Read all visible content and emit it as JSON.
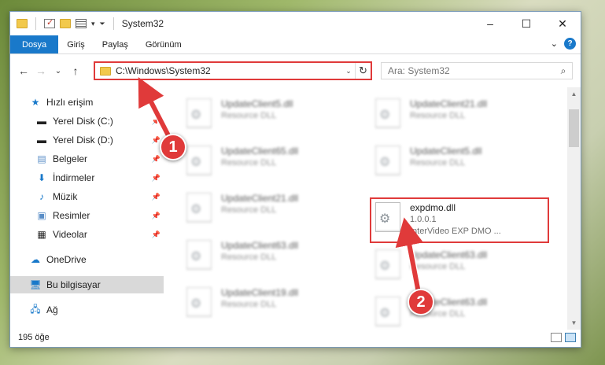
{
  "title_bar": {
    "title": "System32",
    "window_controls": {
      "minimize": "–",
      "maximize": "☐",
      "close": "✕"
    }
  },
  "ribbon": {
    "tabs": [
      "Dosya",
      "Giriş",
      "Paylaş",
      "Görünüm"
    ],
    "expand_glyph": "⌄",
    "help_glyph": "?"
  },
  "navigation": {
    "back": "←",
    "forward": "→",
    "recent": "⌄",
    "up": "↑",
    "address": "C:\\Windows\\System32",
    "refresh": "↻",
    "search_placeholder": "Ara: System32"
  },
  "sidebar": {
    "items": [
      {
        "label": "Hızlı erişim",
        "icon": "star-icon",
        "pinned": false
      },
      {
        "label": "Yerel Disk (C:)",
        "icon": "drive-icon",
        "pinned": true
      },
      {
        "label": "Yerel Disk (D:)",
        "icon": "drive-icon",
        "pinned": true
      },
      {
        "label": "Belgeler",
        "icon": "documents-icon",
        "pinned": true
      },
      {
        "label": "İndirmeler",
        "icon": "download-icon",
        "pinned": true
      },
      {
        "label": "Müzik",
        "icon": "music-icon",
        "pinned": true
      },
      {
        "label": "Resimler",
        "icon": "pictures-icon",
        "pinned": true
      },
      {
        "label": "Videolar",
        "icon": "videos-icon",
        "pinned": true
      },
      {
        "label": "OneDrive",
        "icon": "cloud-icon",
        "pinned": false
      },
      {
        "label": "Bu bilgisayar",
        "icon": "computer-icon",
        "pinned": false,
        "selected": true
      },
      {
        "label": "Ağ",
        "icon": "network-icon",
        "pinned": false
      }
    ]
  },
  "files": {
    "col1": [
      {
        "name": "UpdateClient5.dll",
        "type": "Resource DLL"
      },
      {
        "name": "UpdateClient65.dll",
        "type": "Resource DLL"
      },
      {
        "name": "UpdateClient21.dll",
        "type": "Resource DLL"
      },
      {
        "name": "UpdateClient63.dll",
        "type": "Resource DLL"
      },
      {
        "name": "UpdateClient19.dll",
        "type": "Resource DLL"
      }
    ],
    "col2": [
      {
        "name": "UpdateClient21.dll",
        "type": "Resource DLL"
      },
      {
        "name": "UpdateClient5.dll",
        "type": "Resource DLL"
      },
      {
        "name": "expdmo.dll",
        "version": "1.0.0.1",
        "description": "InterVideo EXP DMO ..."
      },
      {
        "name": "UpdateClient63.dll",
        "type": "Resource DLL"
      },
      {
        "name": "UpdateClient63.dll",
        "type": "Resource DLL"
      }
    ]
  },
  "status_bar": {
    "item_count": "195 öğe"
  },
  "annotations": {
    "step1": "1",
    "step2": "2",
    "accent_color": "#e03a3a"
  }
}
